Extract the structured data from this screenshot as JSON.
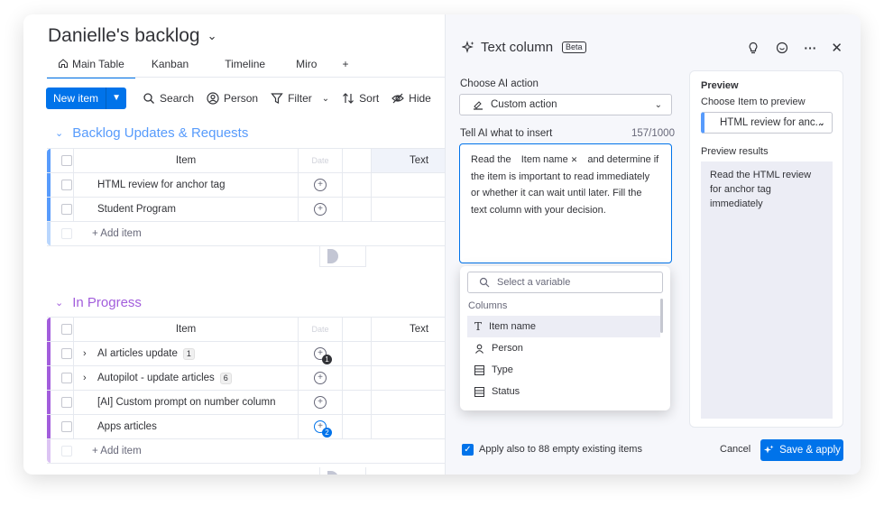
{
  "board": {
    "title": "Danielle's backlog",
    "tabs": [
      {
        "label": "Main Table",
        "active": true
      },
      {
        "label": "Kanban"
      },
      {
        "label": "Timeline"
      },
      {
        "label": "Miro"
      },
      {
        "label": "+"
      }
    ],
    "toolbar": {
      "new_item": "New item",
      "search": "Search",
      "person": "Person",
      "filter": "Filter",
      "sort": "Sort",
      "hide": "Hide"
    },
    "groups": [
      {
        "title": "Backlog Updates & Requests",
        "color": "#579bfc",
        "header_item": "Item",
        "header_people": "Date",
        "header_text": "Text",
        "rows": [
          {
            "name": "HTML review for anchor tag"
          },
          {
            "name": "Student Program"
          }
        ],
        "add_item": "+ Add item"
      },
      {
        "title": "In Progress",
        "color": "#a25ddc",
        "header_item": "Item",
        "header_people": "Date",
        "header_text": "Text",
        "rows": [
          {
            "name": "AI articles update",
            "count": "1",
            "updates": "1"
          },
          {
            "name": "Autopilot - update articles",
            "count": "6"
          },
          {
            "name": "[AI] Custom prompt on number column"
          },
          {
            "name": "Apps articles",
            "updates": "2"
          }
        ],
        "add_item": "+ Add item"
      }
    ]
  },
  "panel": {
    "title": "Text column",
    "badge": "Beta",
    "choose_action_label": "Choose AI action",
    "action_value": "Custom action",
    "tell_label": "Tell AI what to insert",
    "char_count": "157/1000",
    "prompt": {
      "before": "Read the",
      "chip": "Item name",
      "after": "and determine if the item is important to read immediately or whether it can wait until later. Fill the text column with your decision."
    },
    "variables": {
      "placeholder": "Select a variable",
      "section": "Columns",
      "items": [
        "Item name",
        "Person",
        "Type",
        "Status"
      ]
    },
    "preview": {
      "title": "Preview",
      "choose_label": "Choose Item to preview",
      "selected": "HTML review for anc...",
      "results_label": "Preview results",
      "result": "Read the HTML review for anchor tag immediately"
    },
    "footer": {
      "checkbox_label": "Apply also to 88 empty existing items",
      "cancel": "Cancel",
      "save": "Save & apply"
    }
  },
  "colors": {
    "accent": "#0073ea",
    "group1": "#579bfc",
    "group2": "#a25ddc"
  }
}
